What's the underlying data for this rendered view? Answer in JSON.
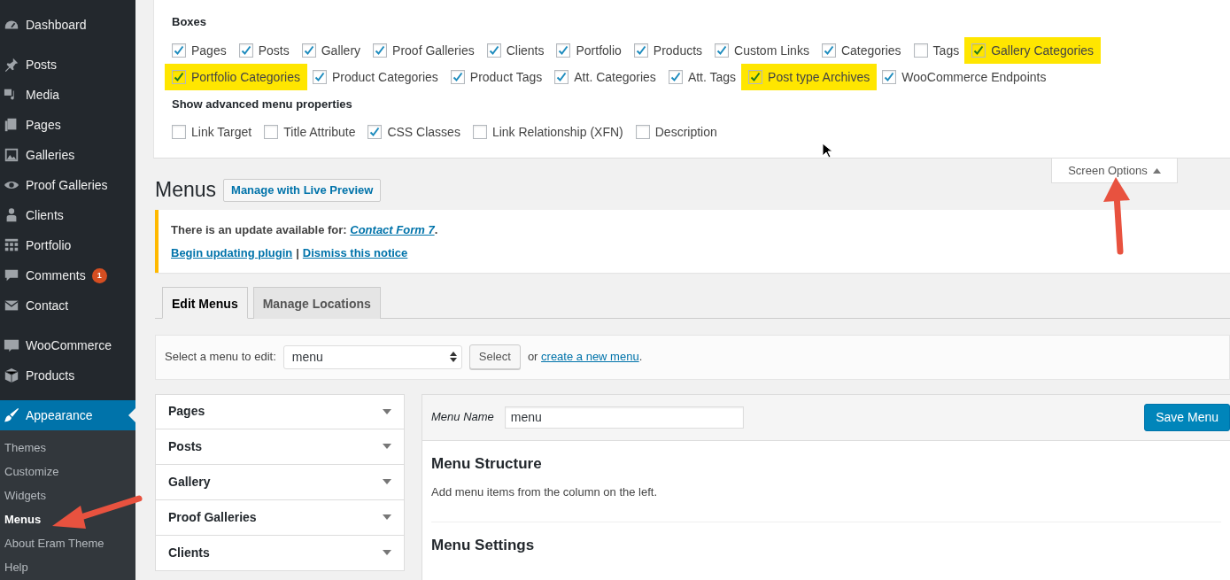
{
  "sidebar": {
    "items": [
      {
        "kind": "item",
        "label": "Dashboard",
        "selected": false
      },
      {
        "kind": "separator"
      },
      {
        "kind": "item",
        "label": "Posts",
        "selected": false
      },
      {
        "kind": "item",
        "label": "Media",
        "selected": false
      },
      {
        "kind": "item",
        "label": "Pages",
        "selected": false
      },
      {
        "kind": "item",
        "label": "Galleries",
        "selected": false
      },
      {
        "kind": "item",
        "label": "Proof Galleries",
        "selected": false
      },
      {
        "kind": "item",
        "label": "Clients",
        "selected": false
      },
      {
        "kind": "item",
        "label": "Portfolio",
        "selected": false
      },
      {
        "kind": "item",
        "label": "Comments",
        "badge": "1",
        "selected": false
      },
      {
        "kind": "item",
        "label": "Contact",
        "selected": false
      },
      {
        "kind": "separator"
      },
      {
        "kind": "item",
        "label": "WooCommerce",
        "selected": false
      },
      {
        "kind": "item",
        "label": "Products",
        "selected": false
      },
      {
        "kind": "separator"
      },
      {
        "kind": "item",
        "label": "Appearance",
        "selected": true,
        "children": [
          {
            "label": "Themes",
            "selected": false
          },
          {
            "label": "Customize",
            "selected": false
          },
          {
            "label": "Widgets",
            "selected": false
          },
          {
            "label": "Menus",
            "selected": true
          },
          {
            "label": "About Eram Theme",
            "selected": false
          },
          {
            "label": "Help",
            "selected": false
          }
        ]
      }
    ]
  },
  "screen_options": {
    "boxes_heading": "Boxes",
    "boxes": [
      {
        "label": "Pages",
        "checked": true,
        "highlighted": false
      },
      {
        "label": "Posts",
        "checked": true,
        "highlighted": false
      },
      {
        "label": "Gallery",
        "checked": true,
        "highlighted": false
      },
      {
        "label": "Proof Galleries",
        "checked": true,
        "highlighted": false
      },
      {
        "label": "Clients",
        "checked": true,
        "highlighted": false
      },
      {
        "label": "Portfolio",
        "checked": true,
        "highlighted": false
      },
      {
        "label": "Products",
        "checked": true,
        "highlighted": false
      },
      {
        "label": "Custom Links",
        "checked": true,
        "highlighted": false
      },
      {
        "label": "Categories",
        "checked": true,
        "highlighted": false
      },
      {
        "label": "Tags",
        "checked": false,
        "highlighted": false
      },
      {
        "label": "Gallery Categories",
        "checked": true,
        "highlighted": true
      },
      {
        "label": "Portfolio Categories",
        "checked": true,
        "highlighted": true
      },
      {
        "label": "Product Categories",
        "checked": true,
        "highlighted": false
      },
      {
        "label": "Product Tags",
        "checked": true,
        "highlighted": false
      },
      {
        "label": "Att. Categories",
        "checked": true,
        "highlighted": false
      },
      {
        "label": "Att. Tags",
        "checked": true,
        "highlighted": false
      },
      {
        "label": "Post type Archives",
        "checked": true,
        "highlighted": true
      },
      {
        "label": "WooCommerce Endpoints",
        "checked": true,
        "highlighted": false
      }
    ],
    "advanced_heading": "Show advanced menu properties",
    "advanced": [
      {
        "label": "Link Target",
        "checked": false,
        "highlighted": false
      },
      {
        "label": "Title Attribute",
        "checked": false,
        "highlighted": false
      },
      {
        "label": "CSS Classes",
        "checked": true,
        "highlighted": false
      },
      {
        "label": "Link Relationship (XFN)",
        "checked": false,
        "highlighted": false
      },
      {
        "label": "Description",
        "checked": false,
        "highlighted": false
      }
    ],
    "toggle": {
      "label": "Screen Options",
      "expanded": true
    }
  },
  "page": {
    "title": "Menus",
    "title_button": "Manage with Live Preview"
  },
  "notice": {
    "text": "There is an update available for: ",
    "link": "Contact Form 7",
    "text_end": ".",
    "actions": [
      "Begin updating plugin",
      "Dismiss this notice"
    ],
    "separator": "|"
  },
  "tabs": [
    {
      "label": "Edit Menus",
      "selected": true
    },
    {
      "label": "Manage Locations",
      "selected": false
    }
  ],
  "select_bar": {
    "label": "Select a menu to edit:",
    "value": "menu",
    "button": "Select",
    "or": "or",
    "link": "create a new menu",
    "end": "."
  },
  "accordion": [
    {
      "title": "Pages"
    },
    {
      "title": "Posts"
    },
    {
      "title": "Gallery"
    },
    {
      "title": "Proof Galleries"
    },
    {
      "title": "Clients"
    }
  ],
  "menu_edit": {
    "name_label": "Menu Name",
    "name_value": "menu",
    "save_button": "Save Menu",
    "structure_heading": "Menu Structure",
    "structure_text": "Add menu items from the column on the left.",
    "settings_heading": "Menu Settings"
  }
}
